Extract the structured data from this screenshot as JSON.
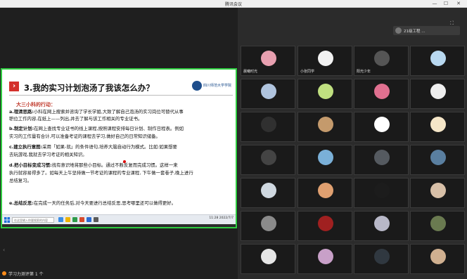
{
  "window": {
    "title": "腾讯会议",
    "minimize_label": "—",
    "maximize_label": "☐",
    "close_label": "✕"
  },
  "self_view": {
    "name": "21级工程 ..."
  },
  "slide": {
    "section_number": "3.",
    "heading": "3.我的实习计划泡汤了我该怎么办？",
    "logo_text": "四川师范大学学院",
    "subheading": "大三小科的行动：",
    "lines": [
      {
        "label": "a.理清思路:",
        "text": "小科在网上搜索并咨询了学长学姐,大致了解自己泡汤的实习岗位可替代从事"
      },
      {
        "label": "",
        "text": "职位工作内容,在纸上——列出,并去了解与该工作相关的专业证书。"
      },
      {
        "label": "b.制定计划:",
        "text": "在网上查找专业证书的线上课程,按照课程安排每日计划、制作日程表。例如"
      },
      {
        "label": "",
        "text": "实习的工作量有合计,可以准备考证的课程去学习,做好自己的日常知识储备。"
      },
      {
        "label": "c.建立执行意图:",
        "text": "采用「如果-就」的条件语句,培养大脑自动行为模式。比如:如果想要"
      },
      {
        "label": "",
        "text": "去玩游戏,我就去学习考证的相关知识。"
      },
      {
        "label": "d.把小目标变成习惯:",
        "text": "找有意识地将那些小目标。通过不断反复而完成习惯。这样一来"
      },
      {
        "label": "",
        "text": "执行就容易得多了。如每天上午坚持做一节考证的课程的专业课程, 下午做一套卷子,晚上进行"
      },
      {
        "label": "",
        "text": "总结复习。"
      },
      {
        "label": "e.总结反思:",
        "text": "在完成一天的任务后,对今天要进行总结反思,思考哪里还可以做得更好。"
      }
    ]
  },
  "taskbar": {
    "search_placeholder": "在这里输入你要搜索的内容",
    "clock": "11:28 2022/7/7"
  },
  "chat_tag": {
    "label": "学习力测评第 1 个"
  },
  "participants": [
    {
      "name": "晨曦时光",
      "avatar_color": "#e8a0b0"
    },
    {
      "name": "小张同学",
      "avatar_color": "#f2f2f2"
    },
    {
      "name": "阳光少年",
      "avatar_color": "#555555"
    },
    {
      "name": "",
      "avatar_color": "#b8d8f0"
    },
    {
      "name": "",
      "avatar_color": "#b0c4de"
    },
    {
      "name": "",
      "avatar_color": "#c0e080"
    },
    {
      "name": "",
      "avatar_color": "#e07090"
    },
    {
      "name": "",
      "avatar_color": "#eeeeee"
    },
    {
      "name": "",
      "avatar_color": "#303030"
    },
    {
      "name": "",
      "avatar_color": "#c49a6c"
    },
    {
      "name": "",
      "avatar_color": "#ffffff"
    },
    {
      "name": "",
      "avatar_color": "#f5e6c8"
    },
    {
      "name": "",
      "avatar_color": "#444444"
    },
    {
      "name": "",
      "avatar_color": "#7ab0d8"
    },
    {
      "name": "",
      "avatar_color": "#555a60"
    },
    {
      "name": "",
      "avatar_color": "#5a7fa0"
    },
    {
      "name": "",
      "avatar_color": "#cfd8e0"
    },
    {
      "name": "",
      "avatar_color": "#e0a070"
    },
    {
      "name": "",
      "avatar_color": "#1c1c1c"
    },
    {
      "name": "",
      "avatar_color": "#d8c0a8"
    },
    {
      "name": "",
      "avatar_color": "#8a8a8a"
    },
    {
      "name": "",
      "avatar_color": "#a02020"
    },
    {
      "name": "",
      "avatar_color": "#b8b8c8"
    },
    {
      "name": "",
      "avatar_color": "#6a7a50"
    },
    {
      "name": "",
      "avatar_color": "#e6e6e6"
    },
    {
      "name": "",
      "avatar_color": "#c8a0c8"
    },
    {
      "name": "",
      "avatar_color": "#303840"
    },
    {
      "name": "",
      "avatar_color": "#d0b090"
    }
  ]
}
